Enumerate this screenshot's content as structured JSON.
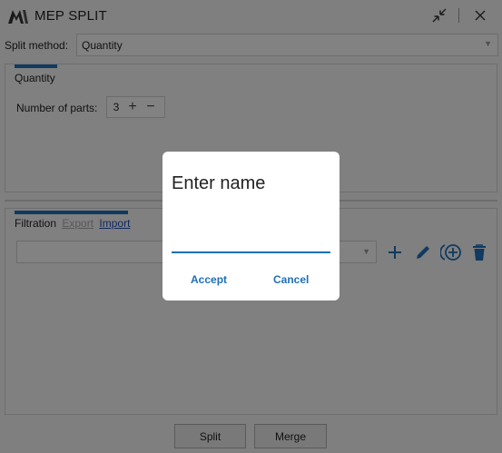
{
  "window": {
    "title": "MEP SPLIT",
    "accent_color": "#1f6fb8"
  },
  "split": {
    "label": "Split method:",
    "selected": "Quantity"
  },
  "quantity_panel": {
    "tab_label": "Quantity",
    "parts_label": "Number of parts:",
    "parts_value": "3",
    "plus_symbol": "+",
    "minus_symbol": "−"
  },
  "filtration_panel": {
    "tabs": [
      {
        "label": "Filtration",
        "state": "active"
      },
      {
        "label": "Export",
        "state": "disabled"
      },
      {
        "label": "Import",
        "state": "link"
      }
    ],
    "actions": [
      "add-icon",
      "edit-icon",
      "add-circle-icon",
      "delete-icon"
    ]
  },
  "footer": {
    "split_label": "Split",
    "merge_label": "Merge"
  },
  "dialog": {
    "title": "Enter name",
    "input_value": "",
    "accept_label": "Accept",
    "cancel_label": "Cancel"
  }
}
